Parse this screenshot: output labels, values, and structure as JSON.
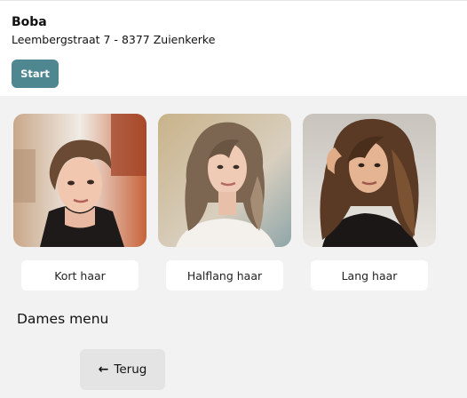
{
  "salon": {
    "name": "Boba",
    "address": "Leembergstraat 7 - 8377 Zuienkerke"
  },
  "actions": {
    "start_label": "Start",
    "back_label": "Terug",
    "back_icon": "arrow-left-icon"
  },
  "menu": {
    "title": "Dames menu",
    "options": [
      {
        "label": "Kort haar",
        "image": "short-hair-photo"
      },
      {
        "label": "Halflang haar",
        "image": "medium-hair-photo"
      },
      {
        "label": "Lang haar",
        "image": "long-hair-photo"
      }
    ]
  },
  "colors": {
    "accent": "#4f8791",
    "page_background": "#f2f2f2",
    "header_background": "#ffffff"
  }
}
